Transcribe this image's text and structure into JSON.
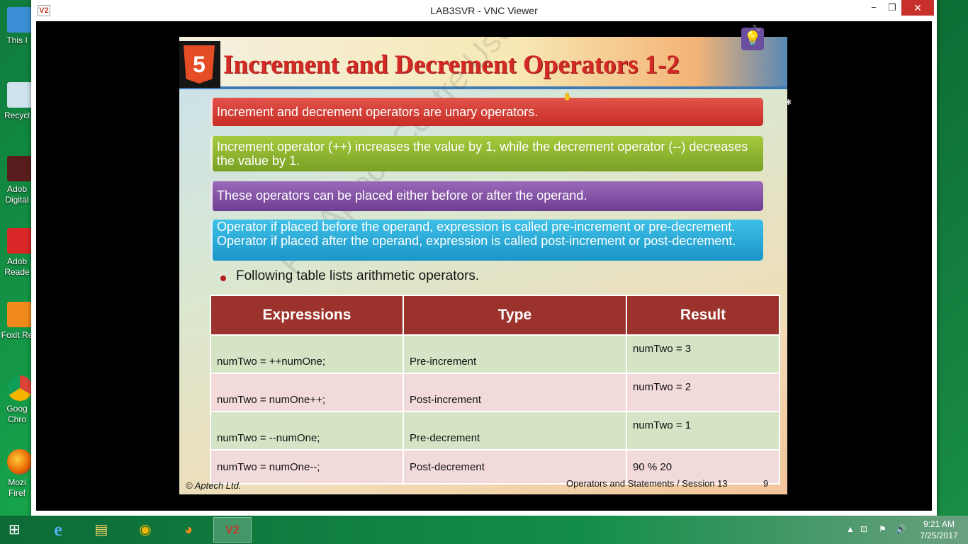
{
  "desktop": {
    "icons": [
      {
        "label": "This I",
        "icon": "computer-icon"
      },
      {
        "label": "Recycl",
        "icon": "recycle-bin-icon"
      },
      {
        "label": "Adob\nDigital",
        "icon": "adobe-digital-editions-icon"
      },
      {
        "label": "Adob\nReade",
        "icon": "adobe-reader-icon"
      },
      {
        "label": "Foxit Re",
        "icon": "foxit-reader-icon"
      },
      {
        "label": "Goog\nChro",
        "icon": "google-chrome-icon"
      },
      {
        "label": "Mozi\nFiref",
        "icon": "firefox-icon"
      }
    ]
  },
  "window": {
    "title": "LAB3SVR - VNC Viewer",
    "app_icon": "V2",
    "minimize": "−",
    "maximize": "❐",
    "close": "✕"
  },
  "slide": {
    "logo_text": "5",
    "title": "Increment and Decrement Operators 1-2",
    "notes": [
      "Increment and decrement operators are unary operators.",
      "Increment operator (++) increases the value by 1, while the decrement operator (--) decreases the value by 1.",
      "These operators can be placed either before or after the operand.",
      "Operator if placed before the operand, expression is called  pre-increment or pre-decrement. Operator if placed after the operand, expression is called post-increment or post-decrement."
    ],
    "bullet": "Following table lists arithmetic operators.",
    "table": {
      "headers": [
        "Expressions",
        "Type",
        "Result"
      ],
      "rows": [
        {
          "expr": "numTwo = ++numOne;",
          "type": "Pre-increment",
          "result": "numTwo = 3"
        },
        {
          "expr": "numTwo = numOne++;",
          "type": "Post-increment",
          "result": "numTwo = 2"
        },
        {
          "expr": "numTwo = --numOne;",
          "type": "Pre-decrement",
          "result": "numTwo = 1"
        },
        {
          "expr": "numTwo = numOne--;",
          "type": "Post-decrement",
          "result": "90 % 20"
        }
      ]
    },
    "footer_left": "© Aptech Ltd.",
    "footer_right": "Operators and Statements / Session 13",
    "page_number": "9",
    "watermark": "For Aptech Centre Use Only"
  },
  "taskbar": {
    "items": [
      {
        "name": "internet-explorer",
        "glyph": "e"
      },
      {
        "name": "file-explorer",
        "glyph": "▤"
      },
      {
        "name": "google-chrome",
        "glyph": "◉"
      },
      {
        "name": "firefox",
        "glyph": "◕"
      },
      {
        "name": "vnc-viewer",
        "glyph": "V2"
      }
    ],
    "time": "9:21 AM",
    "date": "7/25/2017"
  },
  "colors": {
    "title_red": "#d42a25",
    "table_header": "#9b322c",
    "row_green": "#d4e4c5",
    "row_pink": "#f3dada"
  }
}
